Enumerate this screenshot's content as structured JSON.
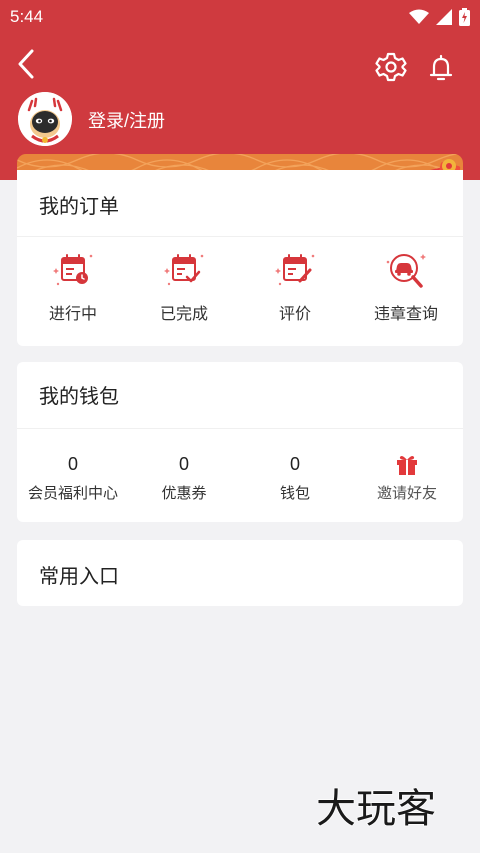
{
  "status": {
    "time": "5:44"
  },
  "header": {
    "login_label": "登录/注册"
  },
  "orders": {
    "title": "我的订单",
    "items": [
      {
        "label": "进行中",
        "icon": "calendar-clock-icon"
      },
      {
        "label": "已完成",
        "icon": "calendar-check-icon"
      },
      {
        "label": "评价",
        "icon": "calendar-edit-icon"
      },
      {
        "label": "违章查询",
        "icon": "car-search-icon"
      }
    ]
  },
  "wallet": {
    "title": "我的钱包",
    "items": [
      {
        "value": "0",
        "label": "会员福利中心"
      },
      {
        "value": "0",
        "label": "优惠券"
      },
      {
        "value": "0",
        "label": "钱包"
      },
      {
        "value": "",
        "label": "邀请好友",
        "icon": "gift-icon"
      }
    ]
  },
  "entries": {
    "title": "常用入口"
  },
  "watermark": {
    "text": "大玩客"
  },
  "colors": {
    "primary": "#cf3a3f",
    "accent": "#e8853b",
    "background": "#f2f2f4"
  }
}
